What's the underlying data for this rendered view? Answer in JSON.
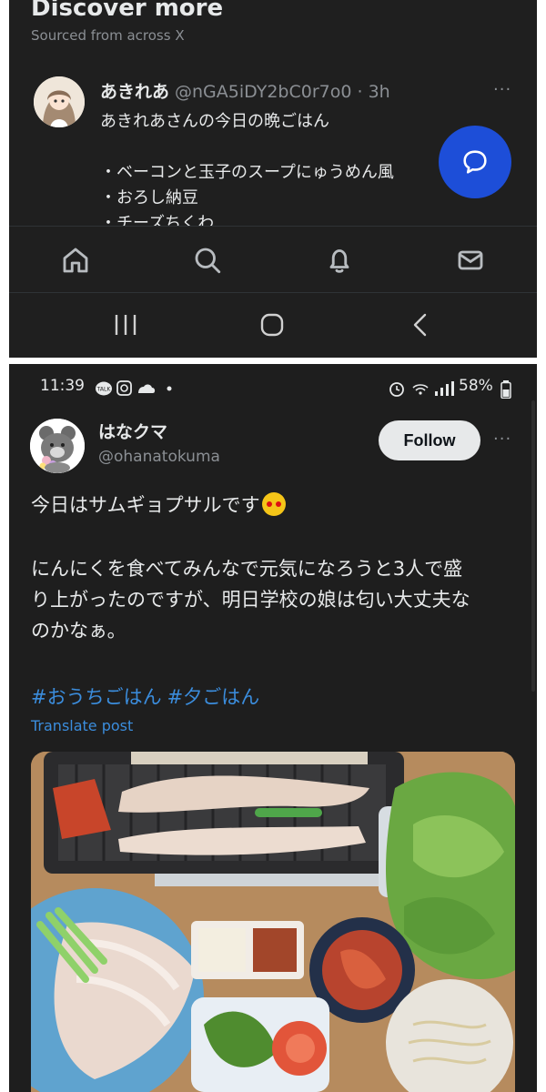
{
  "discover": {
    "title": "Discover more",
    "subtitle": "Sourced from across X"
  },
  "tweet1": {
    "name": "あきれあ",
    "meta": "@nGA5iDY2bC0r7o0 · 3h",
    "more": "···",
    "text": "あきれあさんの今日の晩ごはん\n\n・ベーコンと玉子のスープにゅうめん風\n・おろし納豆\n・チーズちくわ"
  },
  "bottom_nav": {
    "items": [
      "home-icon",
      "search-icon",
      "notifications-icon",
      "messages-icon"
    ]
  },
  "system_nav": {
    "items": [
      "recents-icon",
      "home-circle-icon",
      "back-icon"
    ]
  },
  "status_bar": {
    "time": "11:39",
    "battery": "58%"
  },
  "tweet2": {
    "name": "はなクマ",
    "handle": "@ohanatokuma",
    "follow_label": "Follow",
    "more": "···",
    "line1": "今日はサムギョプサルです",
    "para_line1": "にんにくを食べてみんなで元気になろうと3人で盛",
    "para_line2": "り上がったのですが、明日学校の娘は匂い大丈夫な",
    "para_line3": "のかなぁ。",
    "hashtags": [
      "#おうちごはん",
      "#夕ごはん"
    ],
    "translate": "Translate post"
  },
  "colors": {
    "background": "#1f1f1f",
    "link": "#3b8ddd",
    "fab": "#1d4ed8"
  }
}
